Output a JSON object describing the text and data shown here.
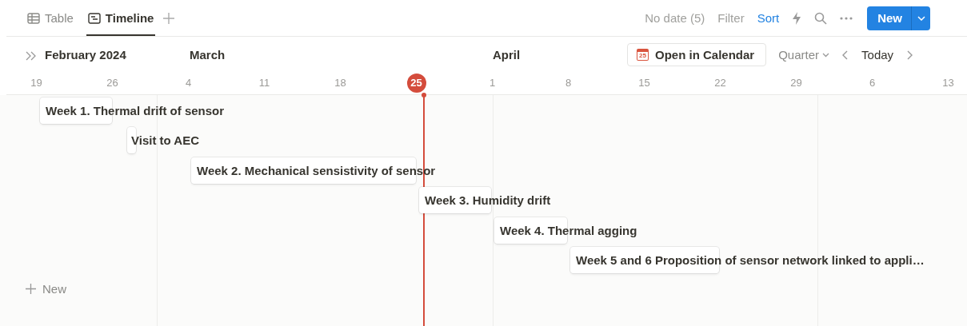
{
  "tabs": [
    {
      "label": "Table",
      "kind": "table",
      "selected": false
    },
    {
      "label": "Timeline",
      "kind": "timeline",
      "selected": true
    }
  ],
  "toolbar": {
    "no_date": "No date (5)",
    "filter": "Filter",
    "sort": "Sort",
    "new_button": "New"
  },
  "timeline": {
    "months": [
      "February 2024",
      "March",
      "April"
    ],
    "open_calendar": "Open in Calendar",
    "calendar_icon_day": "25",
    "range": "Quarter",
    "today": "Today",
    "days": [
      {
        "label": "19",
        "today": false
      },
      {
        "label": "26",
        "today": false
      },
      {
        "label": "4",
        "today": false
      },
      {
        "label": "11",
        "today": false
      },
      {
        "label": "18",
        "today": false
      },
      {
        "label": "25",
        "today": true
      },
      {
        "label": "1",
        "today": false
      },
      {
        "label": "8",
        "today": false
      },
      {
        "label": "15",
        "today": false
      },
      {
        "label": "22",
        "today": false
      },
      {
        "label": "29",
        "today": false
      },
      {
        "label": "6",
        "today": false
      },
      {
        "label": "13",
        "today": false
      }
    ],
    "items": [
      {
        "title": "Week 1. Thermal drift of sensor"
      },
      {
        "title": "Visit to AEC"
      },
      {
        "title": "Week 2. Mechanical sensistivity of sensor"
      },
      {
        "title": "Week 3. Humidity drift"
      },
      {
        "title": "Week 4. Thermal agging"
      },
      {
        "title": "Week 5 and 6 Proposition of sensor network linked to appli…"
      }
    ],
    "new_item": "New"
  }
}
